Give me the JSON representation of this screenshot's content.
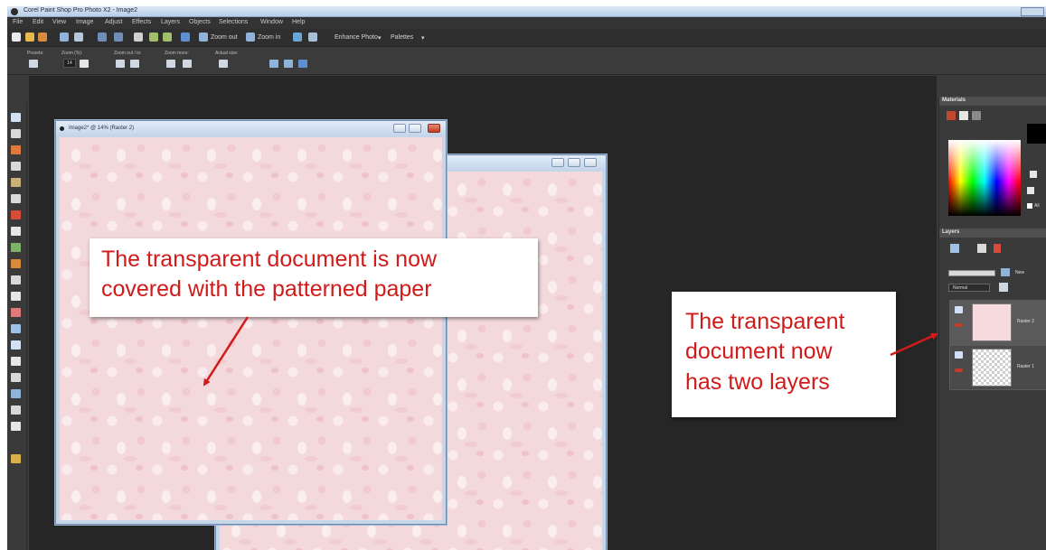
{
  "titlebar": {
    "title": "Corel Paint Shop Pro Photo X2 - Image2"
  },
  "menu": [
    "File",
    "Edit",
    "View",
    "Image",
    "Adjust",
    "Effects",
    "Layers",
    "Objects",
    "Selections",
    "Window",
    "Help"
  ],
  "toolbar": {
    "zoom_out_label": "Zoom out",
    "zoom_in_label": "Zoom in",
    "enhance_photo_label": "Enhance Photo",
    "palettes_label": "Palettes"
  },
  "tool_options": {
    "presets_label": "Presets:",
    "zoom_pct_label": "Zoom (%):",
    "zoom_value": "14",
    "zoom_out_in_label": "Zoom out / in:",
    "zoom_more_label": "Zoom more:",
    "actual_size_label": "Actual size:"
  },
  "front_window": {
    "title": "Image2* @ 14% (Raster 2)"
  },
  "panels": {
    "materials_title": "Materials",
    "layers_title": "Layers",
    "layers_blend_label": "Normal",
    "layers_new_label": "New",
    "all_tools_label": "All",
    "layers": [
      {
        "name": "Raster 2"
      },
      {
        "name": "Raster 1"
      }
    ]
  },
  "callouts": {
    "left": {
      "line1": "The transparent document is now",
      "line2": "covered with the patterned paper"
    },
    "right": {
      "line1": "The transparent",
      "line2": "document now",
      "line3": "has two layers"
    }
  },
  "colors": {
    "callout_text": "#d11a1a",
    "paper_pink": "#f4d9dc",
    "workspace": "#262626"
  }
}
